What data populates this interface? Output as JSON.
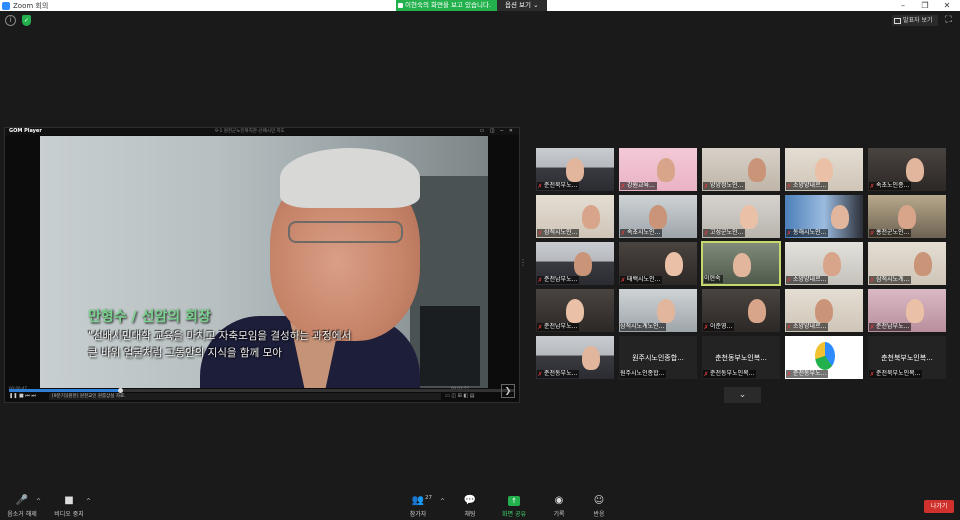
{
  "window": {
    "title": "Zoom 회의",
    "minimize": "–",
    "maximize": "❐",
    "close": "✕"
  },
  "banner": {
    "message": "이현숙의 화면을 보고 있습니다.",
    "options_label": "옵션 보기 ⌄"
  },
  "top_right": {
    "gallery_label": "발표자 보기",
    "fullscreen_glyph": "⛶"
  },
  "top_left": {
    "info_glyph": "i",
    "shield_glyph": "✓"
  },
  "player": {
    "logo": "GOM Player",
    "title": "9-1 원천군노인복지관-선배시민 지도",
    "window_controls": "▭ ◫ ─ ✕",
    "caption_name": "만형수 / 선암의 회장",
    "caption_line1": "\"선배시민대학 교육을 마치고 자축모임을 결성하는 과정에서",
    "caption_line2": "큰 바위 얼굴처럼 그동안의 지식을 함께 모아",
    "time_left": "00:00:47",
    "time_right": "00:03:55",
    "progress": 0.22,
    "file_name": "[9분기][원천] 원천교인 원룸상실 자료.",
    "play_controls": "❚❚ ■ ⏮ ⏭",
    "right_controls": "▭ ◫ ⊞ ◧ ▤",
    "next_glyph": "❯"
  },
  "splitter_glyph": "⋮",
  "gallery": {
    "tiles": [
      {
        "name": "춘천북부노...",
        "muted": true,
        "style": "classroom"
      },
      {
        "name": "강원교육...",
        "muted": true,
        "style": "pink"
      },
      {
        "name": "양양정노인...",
        "muted": true,
        "style": "room"
      },
      {
        "name": "소양양내르...",
        "muted": true,
        "style": "wall"
      },
      {
        "name": "속초노인종...",
        "muted": true,
        "style": "dark"
      },
      {
        "name": "삼척시노인...",
        "muted": true,
        "style": "wall"
      },
      {
        "name": "속초시노인...",
        "muted": true,
        "style": "office"
      },
      {
        "name": "고성군노인...",
        "muted": true,
        "style": "elder"
      },
      {
        "name": "동해시노인...",
        "muted": true,
        "style": "screen"
      },
      {
        "name": "홍천군노인...",
        "muted": true,
        "style": "group"
      },
      {
        "name": "춘천남부노...",
        "muted": true,
        "style": "classroom"
      },
      {
        "name": "태백시노인...",
        "muted": true,
        "style": "dark"
      },
      {
        "name": "이현숙",
        "muted": false,
        "style": "host"
      },
      {
        "name": "소양양내르...",
        "muted": true,
        "style": "hat"
      },
      {
        "name": "삼척시노계...",
        "muted": true,
        "style": "wall"
      },
      {
        "name": "춘천남부노...",
        "muted": true,
        "style": "dark"
      },
      {
        "name": "삼척시노계노인...",
        "muted": false,
        "style": "office"
      },
      {
        "name": "이춘영...",
        "muted": true,
        "style": "dark"
      },
      {
        "name": "소양양내르...",
        "muted": true,
        "style": "wall"
      },
      {
        "name": "춘천남부노...",
        "muted": true,
        "style": "pink2"
      },
      {
        "name": "춘천동부노...",
        "muted": true,
        "style": "classroom"
      },
      {
        "name": "원주시노인종합...",
        "muted": false,
        "style": "text"
      },
      {
        "name": "춘천동부노인복...",
        "muted": true,
        "style": "text"
      },
      {
        "name": "춘천동부노...",
        "muted": true,
        "style": "logo"
      },
      {
        "name": "춘천북부노인복...",
        "muted": true,
        "style": "text"
      }
    ],
    "more_glyph": "⌄"
  },
  "toolbar": {
    "mute": {
      "label": "음소거 해제",
      "glyph": "🎤"
    },
    "video": {
      "label": "비디오 중지",
      "glyph": "■"
    },
    "participants": {
      "label": "참가자",
      "glyph": "👥",
      "count": "27"
    },
    "chat": {
      "label": "채팅",
      "glyph": "💬"
    },
    "share": {
      "label": "화면 공유",
      "glyph": "↑"
    },
    "record": {
      "label": "기록",
      "glyph": "◉"
    },
    "reactions": {
      "label": "반응",
      "glyph": "☺"
    },
    "caret": "^",
    "leave": "나가기"
  }
}
